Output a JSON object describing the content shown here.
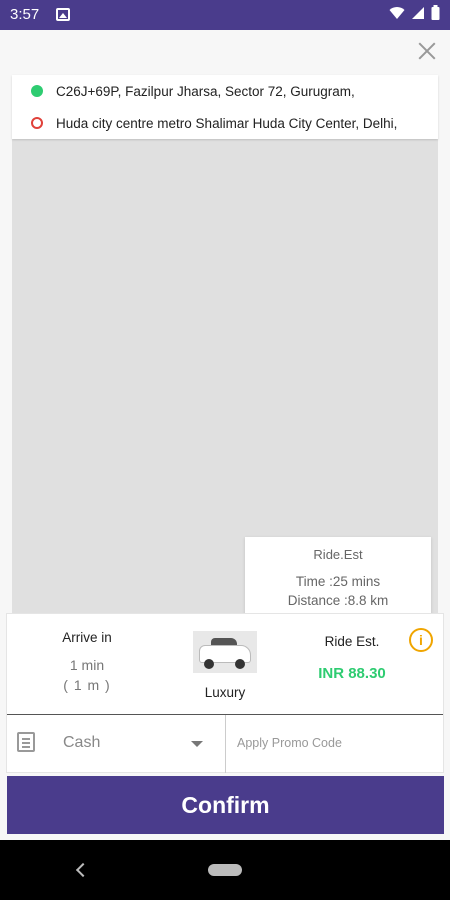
{
  "status_bar": {
    "time": "3:57",
    "icons": [
      "image-icon",
      "wifi-icon",
      "signal-icon",
      "battery-icon"
    ]
  },
  "route": {
    "pickup": "C26J+69P, Fazilpur Jharsa, Sector 72, Gurugram,",
    "drop": "Huda city centre metro Shalimar Huda City Center, Delhi,"
  },
  "ride_estimate_box": {
    "title": "Ride.Est",
    "time": "Time :25 mins",
    "distance": "Distance :8.8 km"
  },
  "booking": {
    "arrive_label": "Arrive in",
    "arrive_min": "1 min",
    "arrive_m": "( 1 m )",
    "car_label": "Luxury",
    "est_label": "Ride Est.",
    "est_value": "INR 88.30",
    "info_glyph": "i"
  },
  "payment": {
    "method": "Cash",
    "promo_placeholder": "Apply Promo Code"
  },
  "confirm_label": "Confirm",
  "colors": {
    "primary": "#4a3c8c",
    "price_green": "#2ecc71",
    "pickup_dot": "#2ecc71",
    "drop_dot": "#e0413a",
    "info": "#f0a500"
  }
}
